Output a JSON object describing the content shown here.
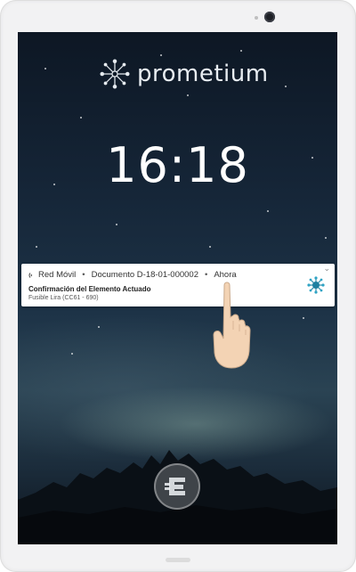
{
  "app": {
    "brand_name": "prometium"
  },
  "lockscreen": {
    "time": "16:18"
  },
  "notification": {
    "app_name": "Red Móvil",
    "document": "Documento D-18-01-000002",
    "when": "Ahora",
    "title": "Confirmación del Elemento Actuado",
    "body": "Fusible Lira  (CC61 - 690)",
    "expand_icon": "chevron-down-icon",
    "app_icon": "network-hub-icon"
  },
  "icons": {
    "logo": "prometium-logo-icon",
    "gesture": "tap-hand-icon",
    "bottom_button": "e-logo-icon"
  },
  "colors": {
    "screen_top": "#0d1724",
    "screen_mid": "#1d3347",
    "accent_teal": "#2b8aa8",
    "hand_skin": "#f3d3b4"
  }
}
